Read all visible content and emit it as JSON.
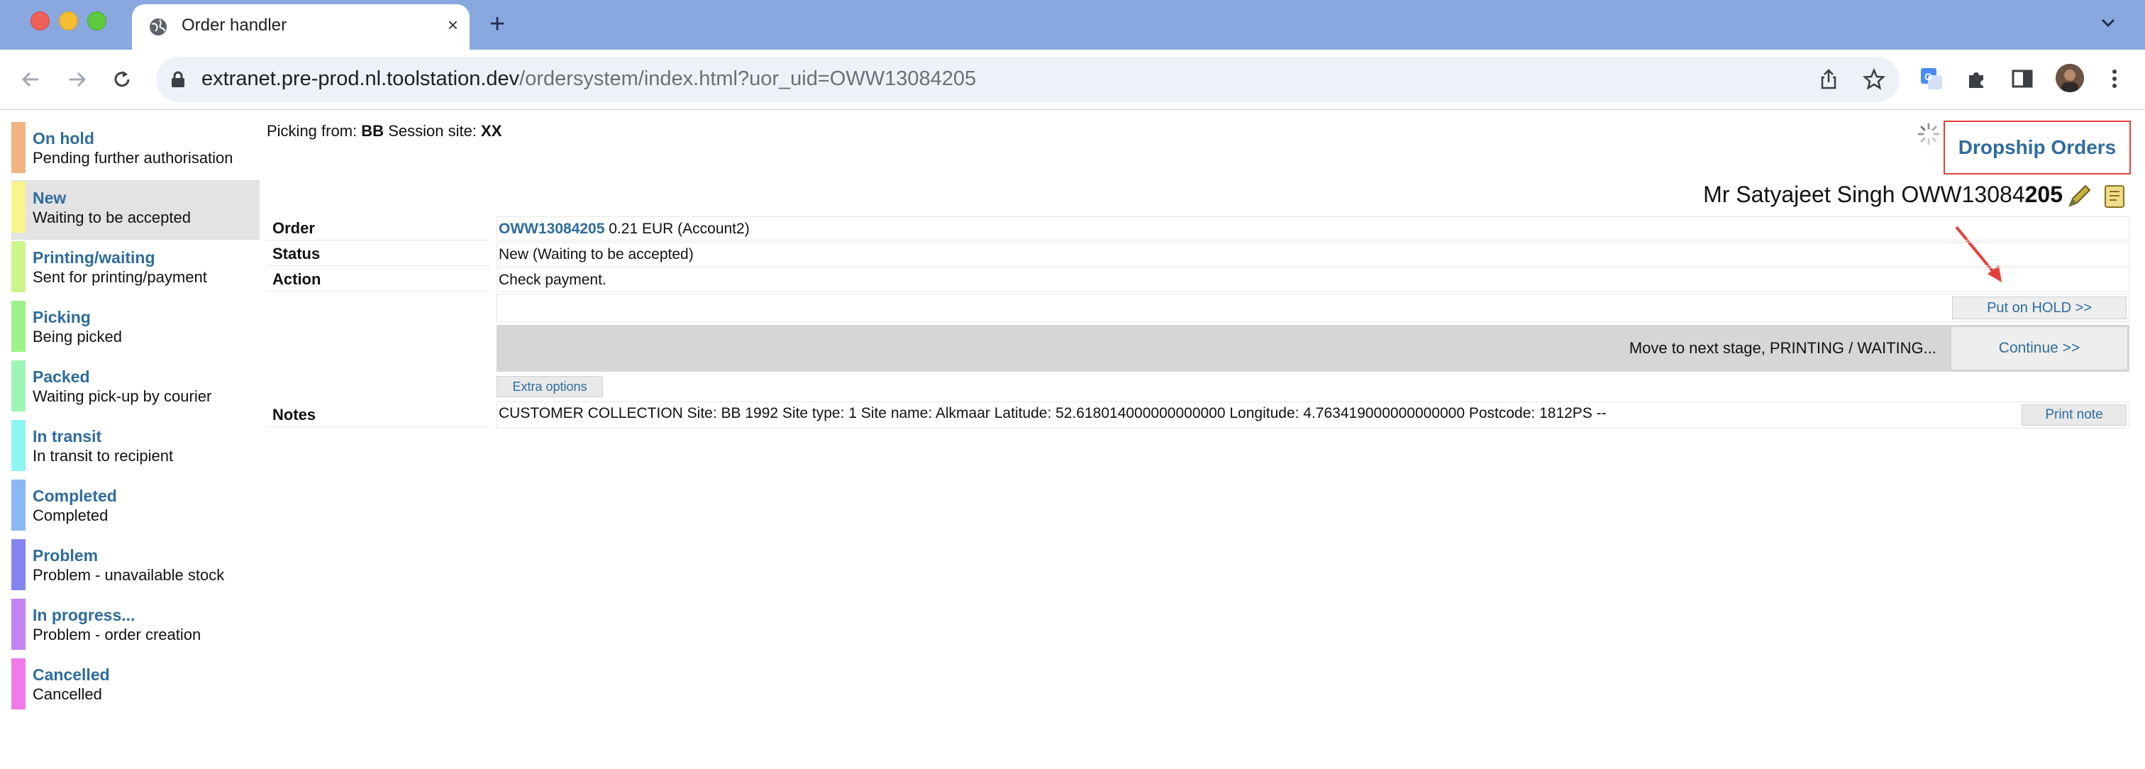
{
  "browser": {
    "tab_title": "Order handler",
    "tab_close": "×",
    "new_tab": "+",
    "url_host": "extranet.pre-prod.nl.toolstation.dev",
    "url_path": "/ordersystem/index.html?uor_uid=OWW13084205"
  },
  "sidebar": {
    "items": [
      {
        "title": "On hold",
        "subtitle": "Pending further authorisation",
        "color": "#f2b483"
      },
      {
        "title": "New",
        "subtitle": "Waiting to be accepted",
        "color": "#fbf58c"
      },
      {
        "title": "Printing/waiting",
        "subtitle": "Sent for printing/payment",
        "color": "#cdf58a"
      },
      {
        "title": "Picking",
        "subtitle": "Being picked",
        "color": "#9ef28a"
      },
      {
        "title": "Packed",
        "subtitle": "Waiting pick-up by courier",
        "color": "#9ef5b6"
      },
      {
        "title": "In transit",
        "subtitle": "In transit to recipient",
        "color": "#8df5f2"
      },
      {
        "title": "Completed",
        "subtitle": "Completed",
        "color": "#8ab8f5"
      },
      {
        "title": "Problem",
        "subtitle": "Problem - unavailable stock",
        "color": "#8484f0"
      },
      {
        "title": "In progress...",
        "subtitle": "Problem - order creation",
        "color": "#c184f2"
      },
      {
        "title": "Cancelled",
        "subtitle": "Cancelled",
        "color": "#f07be8"
      }
    ],
    "selected": "New"
  },
  "header": {
    "picking_label": "Picking from:",
    "picking_value": "BB",
    "session_label": "Session site:",
    "session_value": "XX",
    "dropship_label": "Dropship Orders",
    "customer_prefix": "Mr Satyajeet Singh OWW13084",
    "customer_suffix": "205"
  },
  "order": {
    "order_label": "Order",
    "order_id": "OWW13084205",
    "order_amount": "0.21 EUR (Account2)",
    "status_label": "Status",
    "status_value": "New (Waiting to be accepted)",
    "action_label": "Action",
    "action_value": "Check payment.",
    "hold_button": "Put on HOLD >>",
    "next_stage_text": "Move to next stage, PRINTING / WAITING...",
    "continue_button": "Continue >>",
    "extra_options": "Extra options",
    "notes_label": "Notes",
    "notes_value": "CUSTOMER COLLECTION Site: BB 1992 Site type: 1 Site name: Alkmaar Latitude: 52.618014000000000000 Longitude: 4.763419000000000000 Postcode: 1812PS --",
    "print_note": "Print note"
  },
  "colors": {
    "link": "#2e6c9d",
    "highlight_border": "#e0423a",
    "tabbar": "#8aa8e0"
  }
}
